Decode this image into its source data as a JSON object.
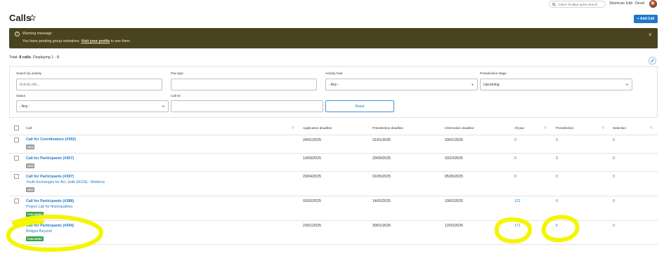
{
  "topbar": {
    "search_placeholder": "Admin Toolbar quick search",
    "links": [
      "Shortcuts",
      "Edit",
      "Devel"
    ]
  },
  "page": {
    "title": "Calls",
    "add_button": "+ Add Call"
  },
  "warning": {
    "title": "Warning message",
    "message_prefix": "You have pending group invitations.",
    "link_text": "Visit your profile",
    "message_suffix": "to see them.",
    "close": "×"
  },
  "summary": {
    "total_label": "Total:",
    "total_value": "8 calls",
    "displaying": ". Displaying 1 - 8."
  },
  "filters": {
    "search_by_activity": {
      "label": "Search by activity",
      "placeholder": "Activity title..."
    },
    "pax_type": {
      "label": "Pax type",
      "value": ""
    },
    "activity_host": {
      "label": "Activity host",
      "value": "- Any -"
    },
    "preselection_stage": {
      "label": "Preselection stage",
      "value": "Upcoming"
    },
    "status": {
      "label": "Status",
      "value": "- Any -"
    },
    "call_id": {
      "label": "Call ID",
      "value": ""
    },
    "reset": "Reset"
  },
  "table": {
    "headers": [
      "Call",
      "Application deadline",
      "Preselection deadline",
      "Information deadline",
      "All pax",
      "Preselection",
      "Selection"
    ],
    "rows": [
      {
        "call": "Call for Coordinators (#392)",
        "sub": "",
        "badge": "NEW",
        "app": "24/01/2025",
        "pre": "31/01/2025",
        "info": "03/01/2025",
        "pax": "0",
        "presel": "0",
        "sel": "0"
      },
      {
        "call": "Call for Participants (#367)",
        "sub": "",
        "badge": "NEW",
        "app": "10/09/2025",
        "pre": "29/09/2025",
        "info": "03/10/2025",
        "pax": "0",
        "presel": "0",
        "sel": "0"
      },
      {
        "call": "Call for Participants (#397)",
        "sub": "Youth Exchanges for ALL (with EECA) - Moldova",
        "badge": "NEW",
        "app": "20/04/2025",
        "pre": "01/05/2025",
        "info": "05/05/2025",
        "pax": "0",
        "presel": "0",
        "sel": "0"
      },
      {
        "call": "Call for Participants (#388)",
        "sub": "Project Lab for Municipalities",
        "badge": "PUBLISHED",
        "app": "02/02/2025",
        "pre": "14/02/2025",
        "info": "19/02/2025",
        "pax": "122",
        "presel": "6",
        "sel": "0"
      },
      {
        "call": "Call for Participants (#394)",
        "sub": "Bridges Beyond",
        "badge": "PUBLISHED",
        "app": "23/01/2025",
        "pre": "30/01/2025",
        "info": "12/02/2025",
        "pax": "171",
        "presel": "6",
        "sel": "0"
      }
    ]
  },
  "colors": {
    "accent": "#1f78c8",
    "warning_bg": "#4a4320",
    "badge_new": "#9e9e9e",
    "badge_published": "#3da34a",
    "annotation": "#f5f500"
  }
}
